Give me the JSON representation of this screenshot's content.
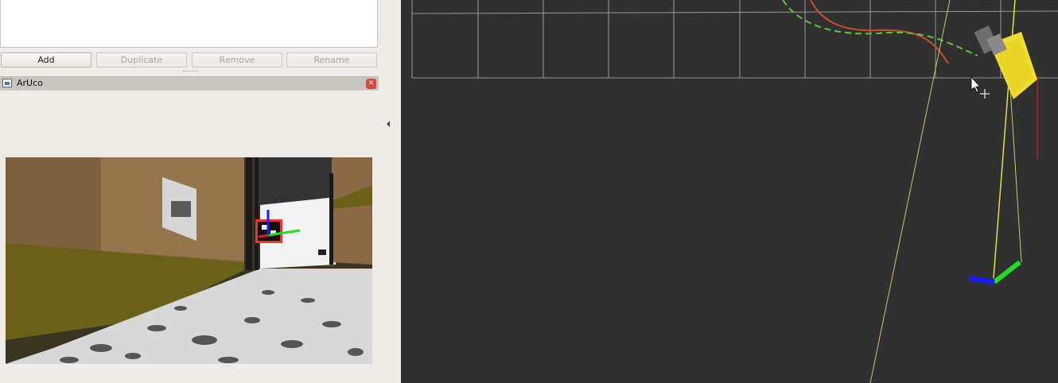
{
  "views_panel": {
    "buttons": {
      "add": "Add",
      "duplicate": "Duplicate",
      "remove": "Remove",
      "rename": "Rename"
    }
  },
  "image_panel": {
    "title": "ArUco"
  },
  "icons": {
    "panel_icon": "image-panel-icon",
    "close": "close-icon",
    "collapse": "collapse-left-arrow-icon",
    "cursor": "mouse-pointer-icon",
    "move_cursor": "move-cursor-icon"
  },
  "colors": {
    "panel_bg": "#efebe7",
    "viewport_bg": "#303030",
    "grid": "#a0a0a0",
    "robot": "#f0dc32",
    "path_red": "#c8502a",
    "path_green": "#5ac832",
    "axis_green": "#22e022",
    "axis_blue": "#1a1aff",
    "axis_red": "#e01a1a"
  }
}
